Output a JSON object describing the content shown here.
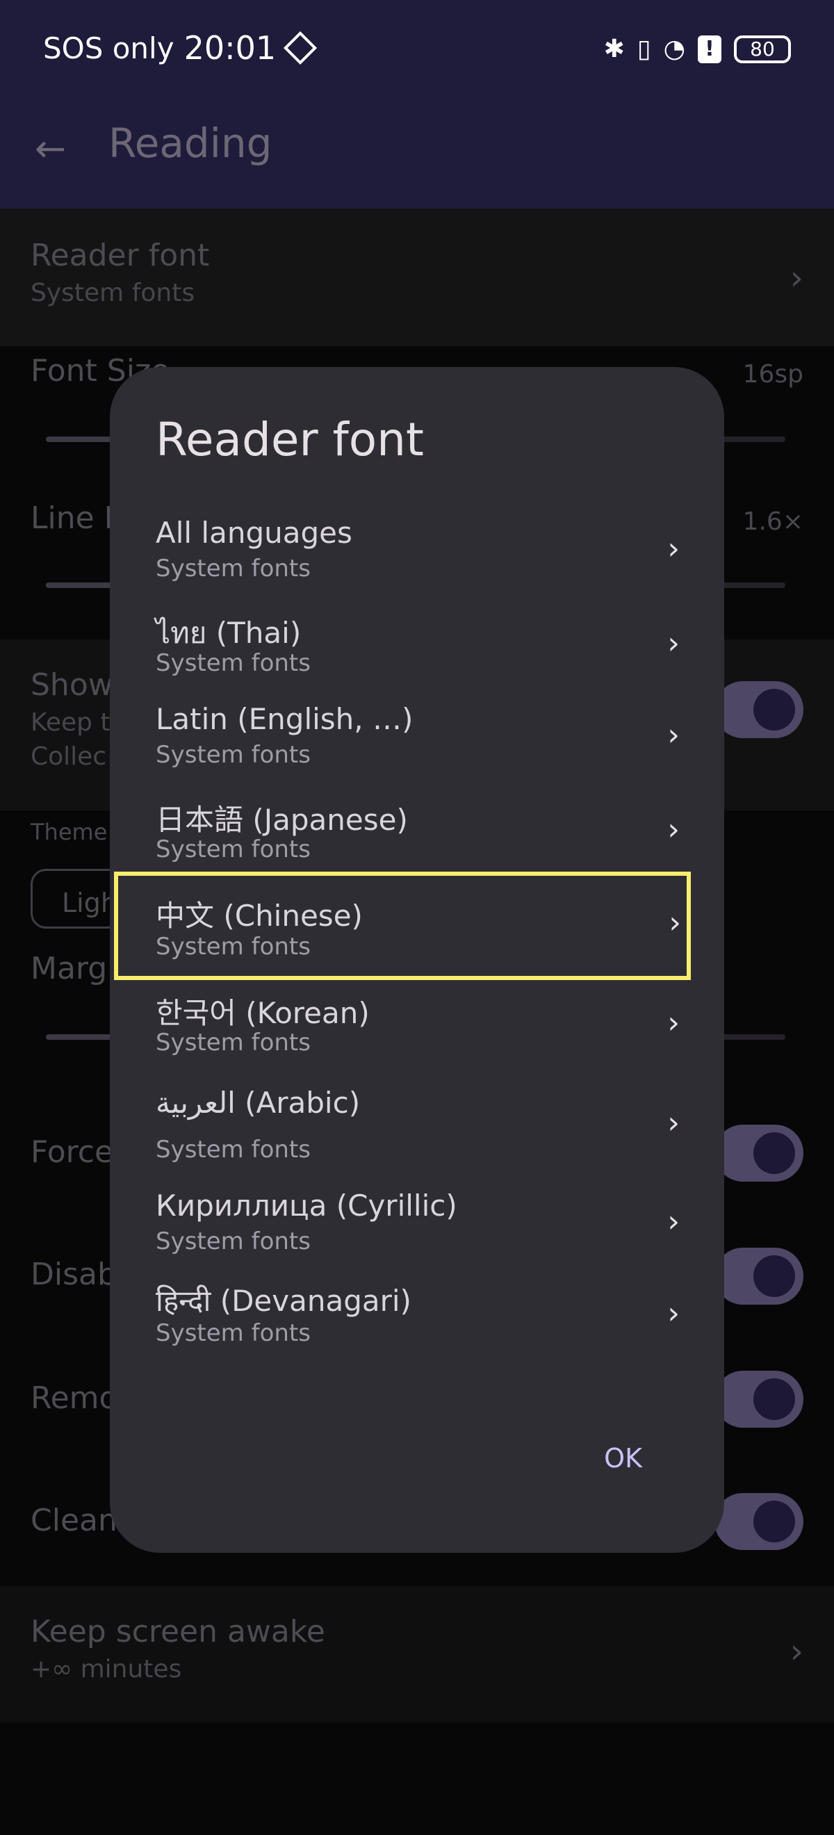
{
  "status_bar": {
    "carrier": "SOS only",
    "time": "20:01",
    "battery": "80",
    "bluetooth_icon": "bluetooth-icon",
    "vibrate_icon": "vibrate-icon",
    "wifi_icon": "wifi-icon"
  },
  "app_bar": {
    "back_icon": "arrow-back-icon",
    "title": "Reading"
  },
  "background_settings": {
    "reader_font": {
      "title": "Reader font",
      "subtitle": "System fonts"
    },
    "font_size": {
      "title": "Font Size",
      "value": "16sp"
    },
    "line_height": {
      "title": "Line H",
      "value": "1.6×"
    },
    "show": {
      "title": "Show",
      "line2": "Keep t",
      "line3": "Collec"
    },
    "theme": {
      "label": "Theme",
      "chip": "Ligh"
    },
    "margin": {
      "title": "Marg"
    },
    "force": {
      "title": "Force"
    },
    "disable": {
      "title": "Disab"
    },
    "remove": {
      "title": "Remo"
    },
    "clean": {
      "title": "Clean"
    },
    "keep_awake": {
      "title": "Keep screen awake",
      "subtitle": "+∞ minutes"
    }
  },
  "dialog": {
    "title": "Reader font",
    "items": [
      {
        "label": "All languages",
        "subtitle": "System fonts"
      },
      {
        "label": "ไทย (Thai)",
        "subtitle": "System fonts"
      },
      {
        "label": "Latin (English, …)",
        "subtitle": "System fonts"
      },
      {
        "label": "日本語 (Japanese)",
        "subtitle": "System fonts"
      },
      {
        "label": "中文 (Chinese)",
        "subtitle": "System fonts"
      },
      {
        "label": "한국어 (Korean)",
        "subtitle": "System fonts"
      },
      {
        "label": "العربية (Arabic)",
        "subtitle": "System fonts"
      },
      {
        "label": "Кириллица (Cyrillic)",
        "subtitle": "System fonts"
      },
      {
        "label": "हिन्दी (Devanagari)",
        "subtitle": "System fonts"
      }
    ],
    "ok_label": "OK"
  },
  "colors": {
    "status_bar": "#1f1b3a",
    "dialog": "#2f2d34",
    "highlight": "#f7ee6c",
    "accent": "#cbc0ff"
  }
}
